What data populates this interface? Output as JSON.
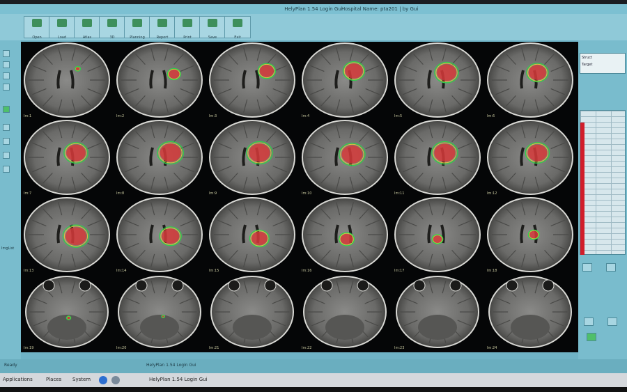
{
  "window": {
    "title": "HelyPlan 1.54 Login Gui",
    "right_info": "Hospital Name: pta201 | by Gui"
  },
  "toolbar": {
    "buttons": [
      "Open",
      "Load",
      "Atlas",
      "3D",
      "Planning",
      "Report",
      "Print",
      "Save",
      "Exit"
    ]
  },
  "left_panel": {
    "label": "ImgList"
  },
  "slices": [
    {
      "label": "Im:1",
      "lesion": 0.05,
      "lx": 0.62,
      "ly": 0.35
    },
    {
      "label": "Im:2",
      "lesion": 0.12,
      "lx": 0.66,
      "ly": 0.42
    },
    {
      "label": "Im:3",
      "lesion": 0.16,
      "lx": 0.66,
      "ly": 0.38
    },
    {
      "label": "Im:4",
      "lesion": 0.2,
      "lx": 0.6,
      "ly": 0.38
    },
    {
      "label": "Im:5",
      "lesion": 0.22,
      "lx": 0.6,
      "ly": 0.4
    },
    {
      "label": "Im:6",
      "lesion": 0.2,
      "lx": 0.58,
      "ly": 0.4
    },
    {
      "label": "Im:7",
      "lesion": 0.22,
      "lx": 0.6,
      "ly": 0.44
    },
    {
      "label": "Im:8",
      "lesion": 0.24,
      "lx": 0.62,
      "ly": 0.44
    },
    {
      "label": "Im:9",
      "lesion": 0.24,
      "lx": 0.58,
      "ly": 0.44
    },
    {
      "label": "Im:10",
      "lesion": 0.24,
      "lx": 0.58,
      "ly": 0.46
    },
    {
      "label": "Im:11",
      "lesion": 0.24,
      "lx": 0.58,
      "ly": 0.44
    },
    {
      "label": "Im:12",
      "lesion": 0.22,
      "lx": 0.58,
      "ly": 0.44
    },
    {
      "label": "Im:13",
      "lesion": 0.24,
      "lx": 0.6,
      "ly": 0.52
    },
    {
      "label": "Im:14",
      "lesion": 0.2,
      "lx": 0.62,
      "ly": 0.52
    },
    {
      "label": "Im:15",
      "lesion": 0.18,
      "lx": 0.58,
      "ly": 0.55
    },
    {
      "label": "Im:16",
      "lesion": 0.14,
      "lx": 0.52,
      "ly": 0.56
    },
    {
      "label": "Im:17",
      "lesion": 0.1,
      "lx": 0.5,
      "ly": 0.56
    },
    {
      "label": "Im:18",
      "lesion": 0.1,
      "lx": 0.54,
      "ly": 0.5
    },
    {
      "label": "Im:19",
      "lesion": 0.04,
      "lx": 0.52,
      "ly": 0.58
    },
    {
      "label": "Im:20",
      "lesion": 0.03,
      "lx": 0.54,
      "ly": 0.56
    },
    {
      "label": "Im:21",
      "lesion": 0,
      "lx": 0.5,
      "ly": 0.5
    },
    {
      "label": "Im:22",
      "lesion": 0,
      "lx": 0.5,
      "ly": 0.5
    },
    {
      "label": "Im:23",
      "lesion": 0,
      "lx": 0.5,
      "ly": 0.5
    },
    {
      "label": "Im:24",
      "lesion": 0,
      "lx": 0.5,
      "ly": 0.5
    }
  ],
  "right_panel": {
    "list_rows": [
      "Struct",
      "Target"
    ]
  },
  "statusbar": {
    "left": "Ready",
    "center": "HelyPlan 1.54 Login Gui"
  },
  "taskbar": {
    "items": [
      "Applications",
      "Places",
      "System"
    ],
    "window_item": "HelyPlan 1.54 Login Gui"
  },
  "colors": {
    "contour_outer": "#2bd44a",
    "contour_inner": "#e0c63c",
    "lesion_fill": "#d63a3a"
  }
}
